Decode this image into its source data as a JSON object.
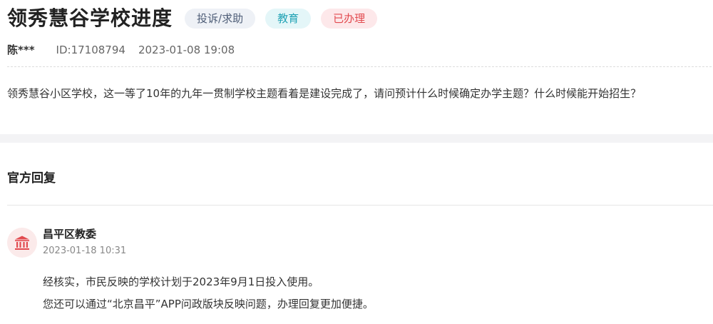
{
  "question": {
    "title": "领秀慧谷学校进度",
    "tags": [
      {
        "label": "投诉/求助",
        "bg": "#eef1f6",
        "color": "#4e5d77"
      },
      {
        "label": "教育",
        "bg": "#e4f6f8",
        "color": "#22a3b5"
      },
      {
        "label": "已办理",
        "bg": "#fde8ea",
        "color": "#e24a4f"
      }
    ],
    "author": "陈***",
    "id_text": "ID:17108794",
    "datetime": "2023-01-08 19:08",
    "content": "领秀慧谷小区学校，这一等了10年的九年一贯制学校主题看着是建设完成了，请问预计什么时候确定办学主题？什么时候能开始招生？"
  },
  "reply": {
    "heading": "官方回复",
    "department": "昌平区教委",
    "avatar_icon": "government-building-icon",
    "datetime": "2023-01-18 10:31",
    "paragraphs": [
      "经核实，市民反映的学校计划于2023年9月1日投入使用。",
      "您还可以通过“北京昌平”APP问政版块反映问题，办理回复更加便捷。"
    ]
  },
  "colors": {
    "accent_red": "#e24a4f",
    "avatar_bg": "#fbeaea",
    "band": "#f3f3f5"
  }
}
